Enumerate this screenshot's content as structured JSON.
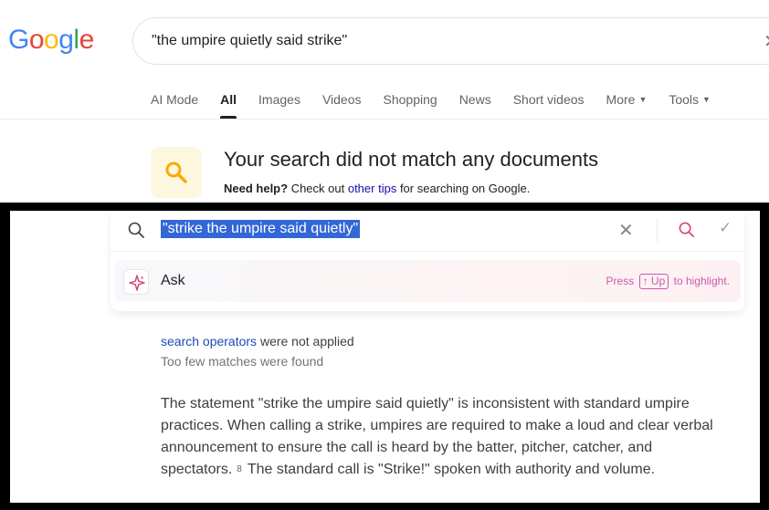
{
  "logo": {
    "letters": [
      "G",
      "o",
      "o",
      "g",
      "l",
      "e"
    ],
    "colors": [
      "#4285F4",
      "#EA4335",
      "#FBBC05",
      "#4285F4",
      "#34A853",
      "#EA4335"
    ]
  },
  "search": {
    "query": "\"the umpire quietly said strike\"",
    "clear_icon": "close-icon"
  },
  "tabs": [
    {
      "label": "AI Mode"
    },
    {
      "label": "All",
      "active": true
    },
    {
      "label": "Images"
    },
    {
      "label": "Videos"
    },
    {
      "label": "Shopping"
    },
    {
      "label": "News"
    },
    {
      "label": "Short videos"
    },
    {
      "label": "More"
    },
    {
      "label": "Tools"
    }
  ],
  "no_results": {
    "title": "Your search did not match any documents",
    "help_bold": "Need help?",
    "help_pre": " Check out ",
    "help_link": "other tips",
    "help_post": " for searching on Google.",
    "icon": "search-icon",
    "icon_color": "#F9AB00"
  },
  "omnibox": {
    "query": "\"strike the umpire said quietly\"",
    "ask_label": "Ask",
    "hint_press": "Press",
    "hint_key": "Up",
    "hint_post": "to highlight.",
    "accent": "#c959b0",
    "selection_color": "#3367d6"
  },
  "result": {
    "operators_link": "search operators",
    "operators_text": " were not applied",
    "few_matches": "Too few matches were found",
    "answer_part1": "The statement \"strike the umpire said quietly\" is inconsistent with standard umpire practices. When calling a strike, umpires are required to make a loud and clear verbal announcement to ensure the call is heard by the batter, pitcher, catcher, and spectators.",
    "citation": "8",
    "answer_part2": "The standard call is \"Strike!\" spoken with authority and volume."
  }
}
